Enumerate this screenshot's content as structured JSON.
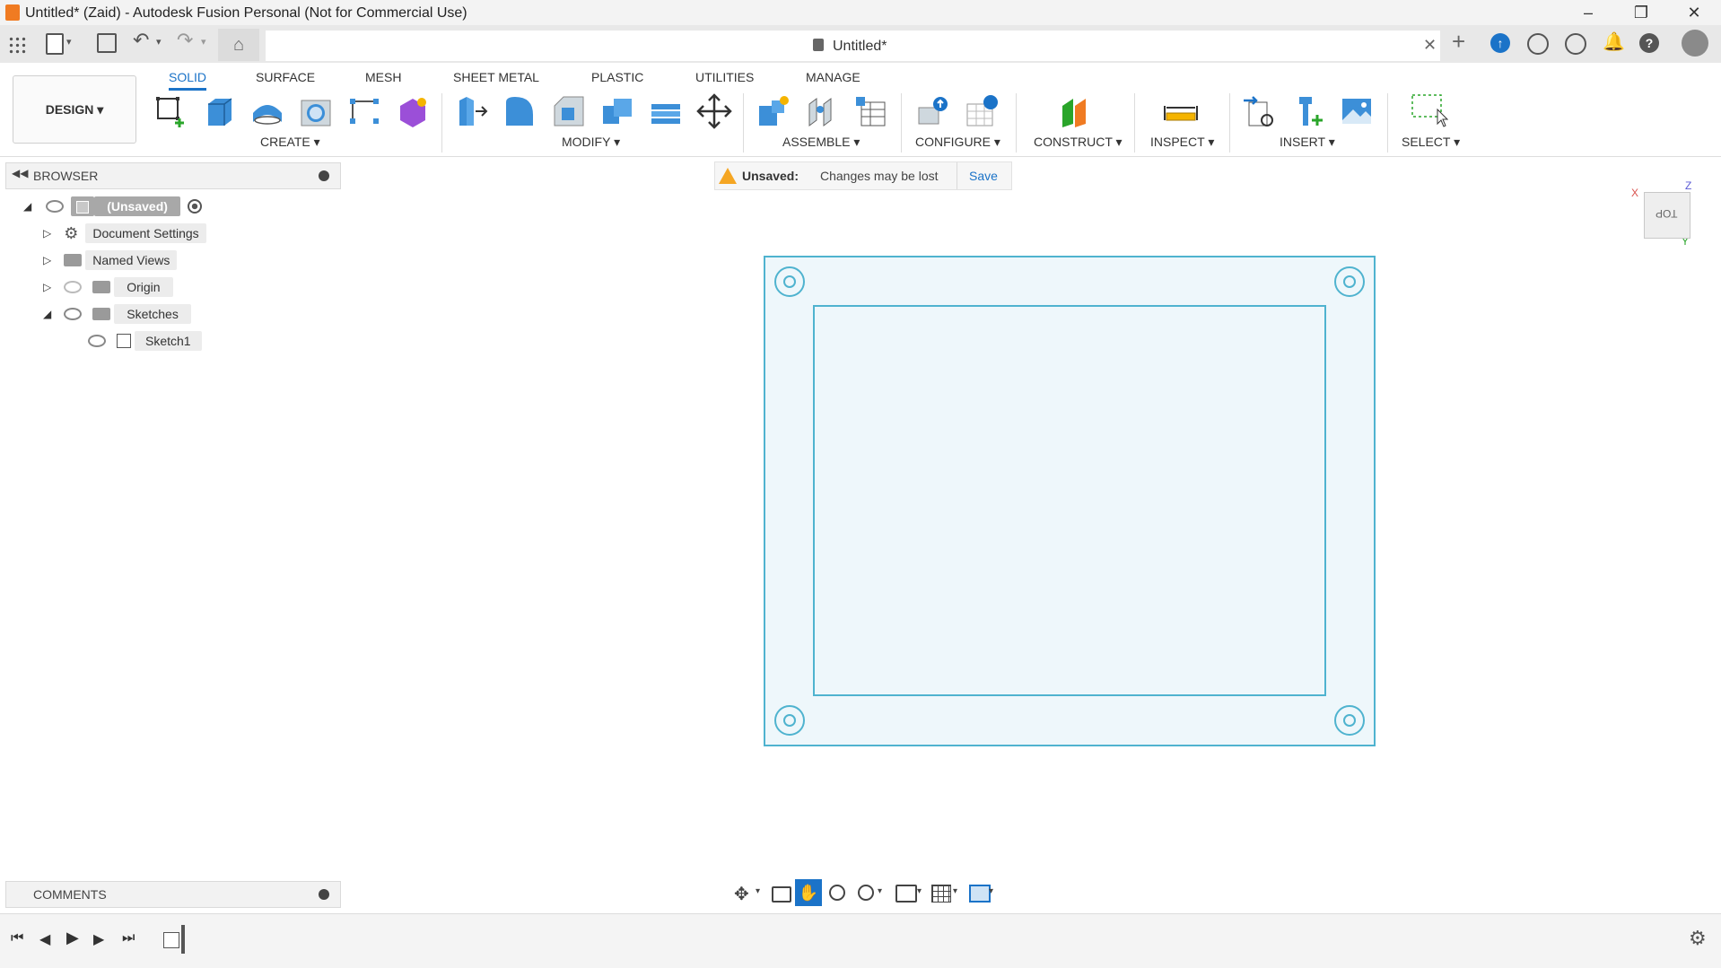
{
  "window": {
    "title": "Untitled* (Zaid) - Autodesk Fusion Personal (Not for Commercial Use)"
  },
  "document": {
    "tab_name": "Untitled*"
  },
  "workspace": {
    "label": "DESIGN ▾"
  },
  "tabs": [
    "SOLID",
    "SURFACE",
    "MESH",
    "SHEET METAL",
    "PLASTIC",
    "UTILITIES",
    "MANAGE"
  ],
  "groups": {
    "create": "CREATE ▾",
    "modify": "MODIFY ▾",
    "assemble": "ASSEMBLE ▾",
    "configure": "CONFIGURE ▾",
    "construct": "CONSTRUCT ▾",
    "inspect": "INSPECT ▾",
    "insert": "INSERT ▾",
    "select": "SELECT ▾"
  },
  "browser": {
    "title": "BROWSER",
    "root": "(Unsaved)",
    "items": [
      "Document Settings",
      "Named Views",
      "Origin",
      "Sketches",
      "Sketch1"
    ]
  },
  "banner": {
    "label": "Unsaved:",
    "message": "Changes may be lost",
    "action": "Save"
  },
  "viewcube": {
    "face": "TOP",
    "axis_x": "X",
    "axis_z": "Z",
    "axis_y": "Y"
  },
  "comments": {
    "title": "COMMENTS"
  },
  "colors": {
    "accent": "#1b73c8",
    "sketch_line": "#4fb3cf",
    "sketch_fill": "#eef7fb",
    "warning": "#f5a623"
  }
}
